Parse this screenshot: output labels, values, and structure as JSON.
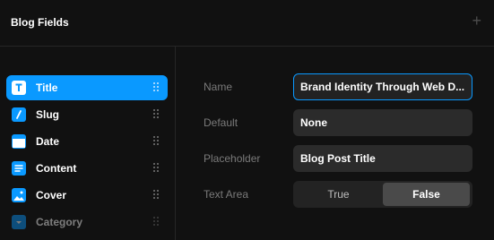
{
  "header": {
    "title": "Blog Fields",
    "add_label": "+"
  },
  "sidebar": {
    "items": [
      {
        "label": "Title",
        "icon": "text-t-icon"
      },
      {
        "label": "Slug",
        "icon": "slug-slash-icon"
      },
      {
        "label": "Date",
        "icon": "calendar-icon"
      },
      {
        "label": "Content",
        "icon": "rich-text-icon"
      },
      {
        "label": "Cover",
        "icon": "image-icon"
      },
      {
        "label": "Category",
        "icon": "dropdown-icon"
      }
    ]
  },
  "form": {
    "name_label": "Name",
    "name_value": "Brand Identity Through Web D...",
    "default_label": "Default",
    "default_value": "None",
    "placeholder_label": "Placeholder",
    "placeholder_value": "Blog Post Title",
    "textarea_label": "Text Area",
    "textarea_true": "True",
    "textarea_false": "False",
    "textarea_selected": "False"
  },
  "colors": {
    "accent": "#0a99ff",
    "background": "#111111",
    "field": "#2b2b2b"
  }
}
